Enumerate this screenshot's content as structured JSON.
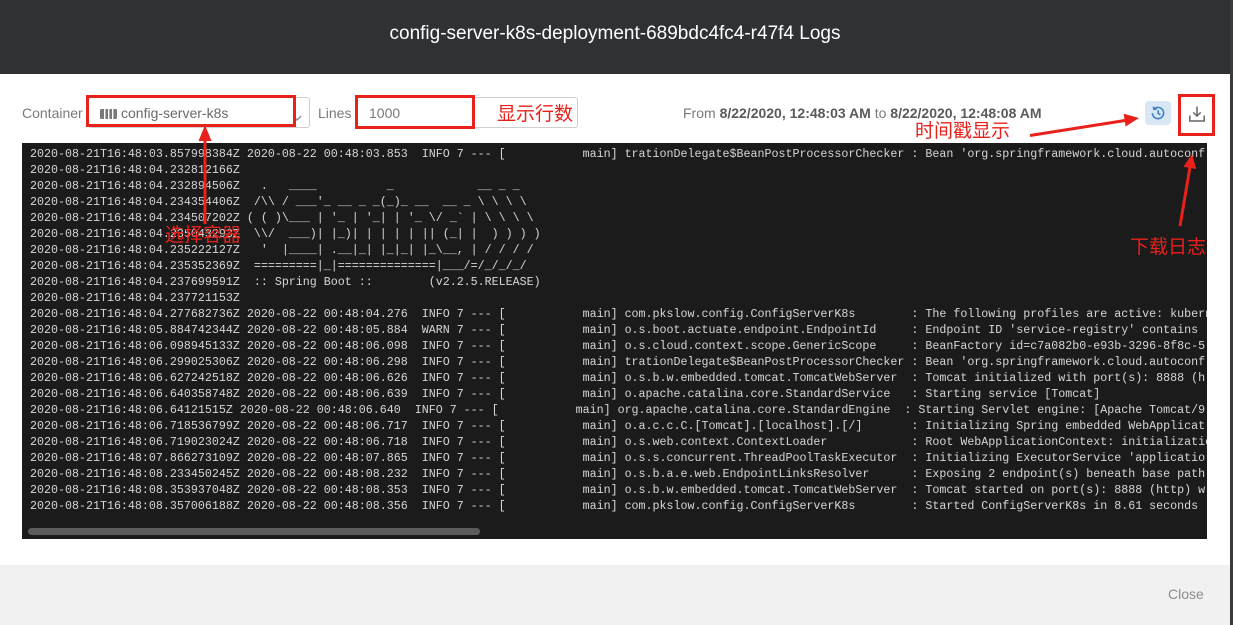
{
  "header": {
    "title": "config-server-k8s-deployment-689bdc4fc4-r47f4 Logs"
  },
  "toolbar": {
    "container_label": "Container",
    "container_icon": "container-icon",
    "container_selected": "config-server-k8s",
    "container_chevron_icon": "chevron-down-icon",
    "lines_label": "Lines",
    "lines_value": "1000",
    "range": {
      "from_label": "From",
      "from": "8/22/2020, 12:48:03 AM",
      "to_label": "to",
      "to": "8/22/2020, 12:48:08 AM"
    },
    "timestamp_button_icon": "history-icon",
    "download_button_icon": "download-icon"
  },
  "annotations": {
    "color": "#e8211b",
    "container_note": "选择容器",
    "lines_note": "显示行数",
    "timestamp_note": "时间戳显示",
    "download_note": "下载日志"
  },
  "log": {
    "lines": [
      "2020-08-21T16:48:03.857998384Z 2020-08-22 00:48:03.853  INFO 7 --- [           main] trationDelegate$BeanPostProcessorChecker : Bean 'org.springframework.cloud.autoconf",
      "2020-08-21T16:48:04.232812166Z",
      "2020-08-21T16:48:04.232894506Z   .   ____          _            __ _ _",
      "2020-08-21T16:48:04.234354406Z  /\\\\ / ___'_ __ _ _(_)_ __  __ _ \\ \\ \\ \\",
      "2020-08-21T16:48:04.234507202Z ( ( )\\___ | '_ | '_| | '_ \\/ _` | \\ \\ \\ \\",
      "2020-08-21T16:48:04.235043293Z  \\\\/  ___)| |_)| | | | | || (_| |  ) ) ) )",
      "2020-08-21T16:48:04.235222127Z   '  |____| .__|_| |_|_| |_\\__, | / / / /",
      "2020-08-21T16:48:04.235352369Z  =========|_|==============|___/=/_/_/_/",
      "2020-08-21T16:48:04.237699591Z  :: Spring Boot ::        (v2.2.5.RELEASE)",
      "2020-08-21T16:48:04.237721153Z",
      "2020-08-21T16:48:04.277682736Z 2020-08-22 00:48:04.276  INFO 7 --- [           main] com.pkslow.config.ConfigServerK8s        : The following profiles are active: kubern",
      "2020-08-21T16:48:05.884742344Z 2020-08-22 00:48:05.884  WARN 7 --- [           main] o.s.boot.actuate.endpoint.EndpointId     : Endpoint ID 'service-registry' contains",
      "2020-08-21T16:48:06.098945133Z 2020-08-22 00:48:06.098  INFO 7 --- [           main] o.s.cloud.context.scope.GenericScope     : BeanFactory id=c7a082b0-e93b-3296-8f8c-5",
      "2020-08-21T16:48:06.299025306Z 2020-08-22 00:48:06.298  INFO 7 --- [           main] trationDelegate$BeanPostProcessorChecker : Bean 'org.springframework.cloud.autoconf",
      "2020-08-21T16:48:06.627242518Z 2020-08-22 00:48:06.626  INFO 7 --- [           main] o.s.b.w.embedded.tomcat.TomcatWebServer  : Tomcat initialized with port(s): 8888 (h",
      "2020-08-21T16:48:06.640358748Z 2020-08-22 00:48:06.639  INFO 7 --- [           main] o.apache.catalina.core.StandardService   : Starting service [Tomcat]",
      "2020-08-21T16:48:06.64121515Z 2020-08-22 00:48:06.640  INFO 7 --- [           main] org.apache.catalina.core.StandardEngine  : Starting Servlet engine: [Apache Tomcat/9",
      "2020-08-21T16:48:06.718536799Z 2020-08-22 00:48:06.717  INFO 7 --- [           main] o.a.c.c.C.[Tomcat].[localhost].[/]       : Initializing Spring embedded WebApplicat",
      "2020-08-21T16:48:06.719023024Z 2020-08-22 00:48:06.718  INFO 7 --- [           main] o.s.web.context.ContextLoader            : Root WebApplicationContext: initializatio",
      "2020-08-21T16:48:07.866273109Z 2020-08-22 00:48:07.865  INFO 7 --- [           main] o.s.s.concurrent.ThreadPoolTaskExecutor  : Initializing ExecutorService 'applicatio",
      "2020-08-21T16:48:08.233450245Z 2020-08-22 00:48:08.232  INFO 7 --- [           main] o.s.b.a.e.web.EndpointLinksResolver      : Exposing 2 endpoint(s) beneath base path",
      "2020-08-21T16:48:08.353937048Z 2020-08-22 00:48:08.353  INFO 7 --- [           main] o.s.b.w.embedded.tomcat.TomcatWebServer  : Tomcat started on port(s): 8888 (http) w",
      "2020-08-21T16:48:08.357006188Z 2020-08-22 00:48:08.356  INFO 7 --- [           main] com.pkslow.config.ConfigServerK8s        : Started ConfigServerK8s in 8.61 seconds"
    ]
  },
  "footer": {
    "close_label": "Close"
  },
  "colors": {
    "header_bg": "#2f3235",
    "log_bg": "#1b1b1b",
    "log_text": "#d6d6d6",
    "timestamp_button_bg": "#d9e7f5",
    "accent": "#3d80c4",
    "footer_bg": "#f1f1f1"
  }
}
